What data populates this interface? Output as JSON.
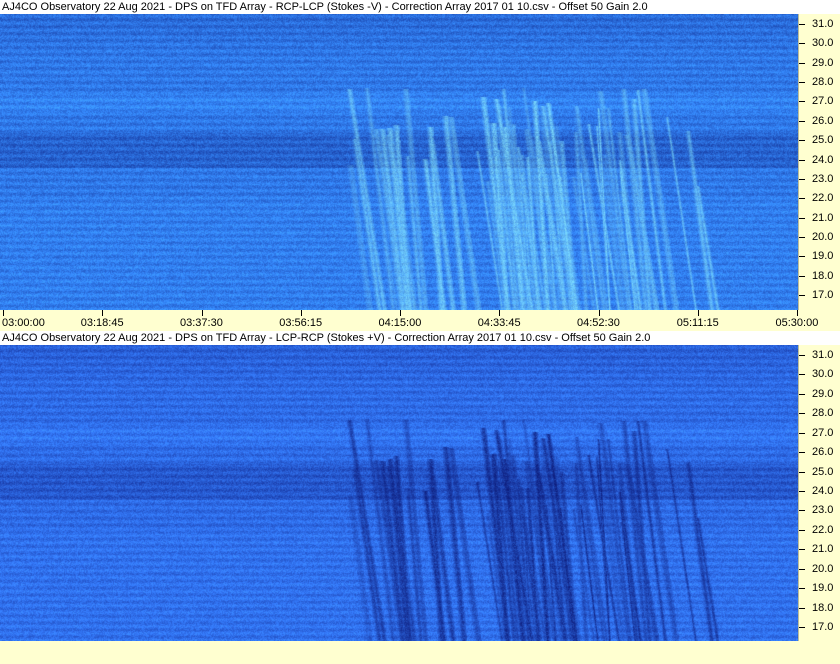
{
  "top_panel": {
    "title": "AJ4CO Observatory 22 Aug 2021  -  DPS on TFD Array  -  RCP-LCP (Stokes -V)  -  Correction Array 2017 01 10.csv  -  Offset 50  Gain 2.0",
    "freq_labels": [
      "31.0",
      "30.0",
      "29.0",
      "28.0",
      "27.0",
      "26.0",
      "25.0",
      "24.0",
      "23.0",
      "22.0",
      "21.0",
      "20.0",
      "19.0",
      "18.0",
      "17.0"
    ],
    "time_labels": [
      "03:00:00",
      "03:18:45",
      "03:37:30",
      "03:56:15",
      "04:15:00",
      "04:33:45",
      "04:52:30",
      "05:11:15",
      "05:30:00"
    ],
    "polarity": "bright",
    "colors": {
      "background": "#2f78e8",
      "burst": "#8ef0ff"
    }
  },
  "bottom_panel": {
    "title": "AJ4CO Observatory 22 Aug 2021  -  DPS on TFD Array  -  LCP-RCP (Stokes +V)  -  Correction Array 2017 01 10.csv  -  Offset 50  Gain 2.0",
    "freq_labels": [
      "31.0",
      "30.0",
      "29.0",
      "28.0",
      "27.0",
      "26.0",
      "25.0",
      "24.0",
      "23.0",
      "22.0",
      "21.0",
      "20.0",
      "19.0",
      "18.0",
      "17.0"
    ],
    "polarity": "dark",
    "colors": {
      "background": "#2e6be6",
      "burst": "#08106a"
    }
  },
  "colors": {
    "axis_background": "#ffffd0",
    "title_background": "#ffffff"
  }
}
